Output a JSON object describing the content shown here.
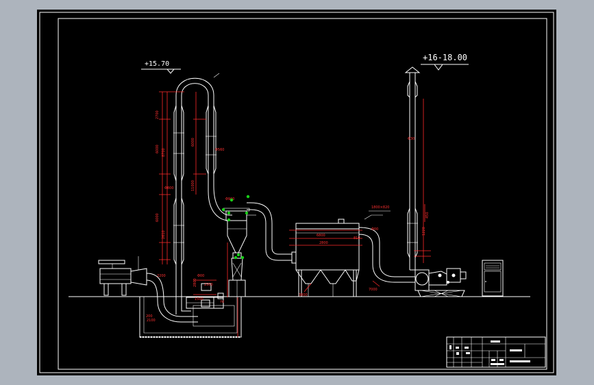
{
  "drawing": {
    "elevation_left": "+15.70",
    "elevation_right": "+16-18.00",
    "colors": {
      "background": "#000000",
      "frame": "#ffffff",
      "dimension": "#ff2a2a",
      "grip": "#18d018",
      "viewport": "#adb4bd"
    }
  }
}
